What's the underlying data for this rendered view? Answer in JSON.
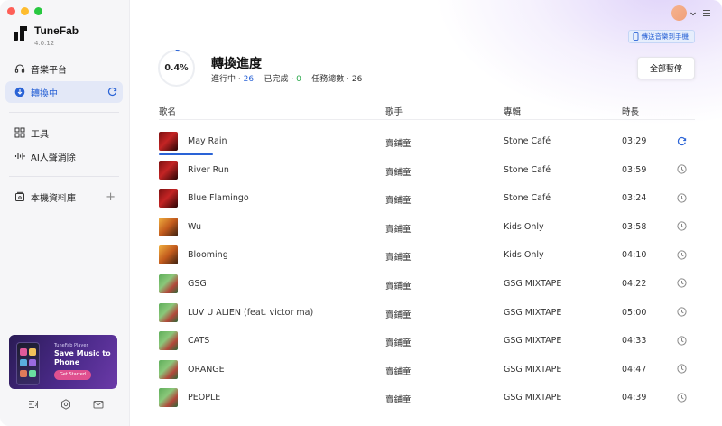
{
  "app": {
    "name": "TuneFab",
    "version": "4.0.12"
  },
  "sidebar": {
    "items": [
      {
        "label": "音樂平台",
        "icon": "headphones-icon"
      },
      {
        "label": "轉換中",
        "icon": "download-circle-icon",
        "active": true
      },
      {
        "label": "工具",
        "icon": "grid-icon"
      },
      {
        "label": "AI人聲消除",
        "icon": "waveform-icon"
      },
      {
        "label": "本機資料庫",
        "icon": "library-icon"
      }
    ],
    "promo": {
      "small": "TuneFab Player",
      "title": "Save Music to Phone",
      "button": "Get Started"
    }
  },
  "header": {
    "phone_link": "傳送音樂到手機",
    "accent": "#2a63d6"
  },
  "progress": {
    "percent_label": "0.4%",
    "percent": 0.004,
    "title": "轉換進度",
    "in_progress_label": "進行中 · ",
    "in_progress": "26",
    "done_label": "已完成 · ",
    "done": "0",
    "total_label": "任務總數 · ",
    "total": "26",
    "pause_all": "全部暫停"
  },
  "table": {
    "columns": [
      "歌名",
      "歌手",
      "專輯",
      "時長"
    ],
    "rows": [
      {
        "title": "May Rain",
        "artist": "賣鋪童",
        "album": "Stone Café",
        "duration": "03:29",
        "status": "converting",
        "cover": "red"
      },
      {
        "title": "River Run",
        "artist": "賣鋪童",
        "album": "Stone Café",
        "duration": "03:59",
        "status": "waiting",
        "cover": "red"
      },
      {
        "title": "Blue Flamingo",
        "artist": "賣鋪童",
        "album": "Stone Café",
        "duration": "03:24",
        "status": "waiting",
        "cover": "red"
      },
      {
        "title": "Wu",
        "artist": "賣鋪童",
        "album": "Kids Only",
        "duration": "03:58",
        "status": "waiting",
        "cover": "kid"
      },
      {
        "title": "Blooming",
        "artist": "賣鋪童",
        "album": "Kids Only",
        "duration": "04:10",
        "status": "waiting",
        "cover": "kid"
      },
      {
        "title": "GSG",
        "artist": "賣鋪童",
        "album": "GSG MIXTAPE",
        "duration": "04:22",
        "status": "waiting",
        "cover": "gsg"
      },
      {
        "title": "LUV U ALIEN (feat. victor ma)",
        "artist": "賣鋪童",
        "album": "GSG MIXTAPE",
        "duration": "05:00",
        "status": "waiting",
        "cover": "gsg"
      },
      {
        "title": "CATS",
        "artist": "賣鋪童",
        "album": "GSG MIXTAPE",
        "duration": "04:33",
        "status": "waiting",
        "cover": "gsg"
      },
      {
        "title": "ORANGE",
        "artist": "賣鋪童",
        "album": "GSG MIXTAPE",
        "duration": "04:47",
        "status": "waiting",
        "cover": "gsg"
      },
      {
        "title": "PEOPLE",
        "artist": "賣鋪童",
        "album": "GSG MIXTAPE",
        "duration": "04:39",
        "status": "waiting",
        "cover": "gsg"
      }
    ]
  }
}
